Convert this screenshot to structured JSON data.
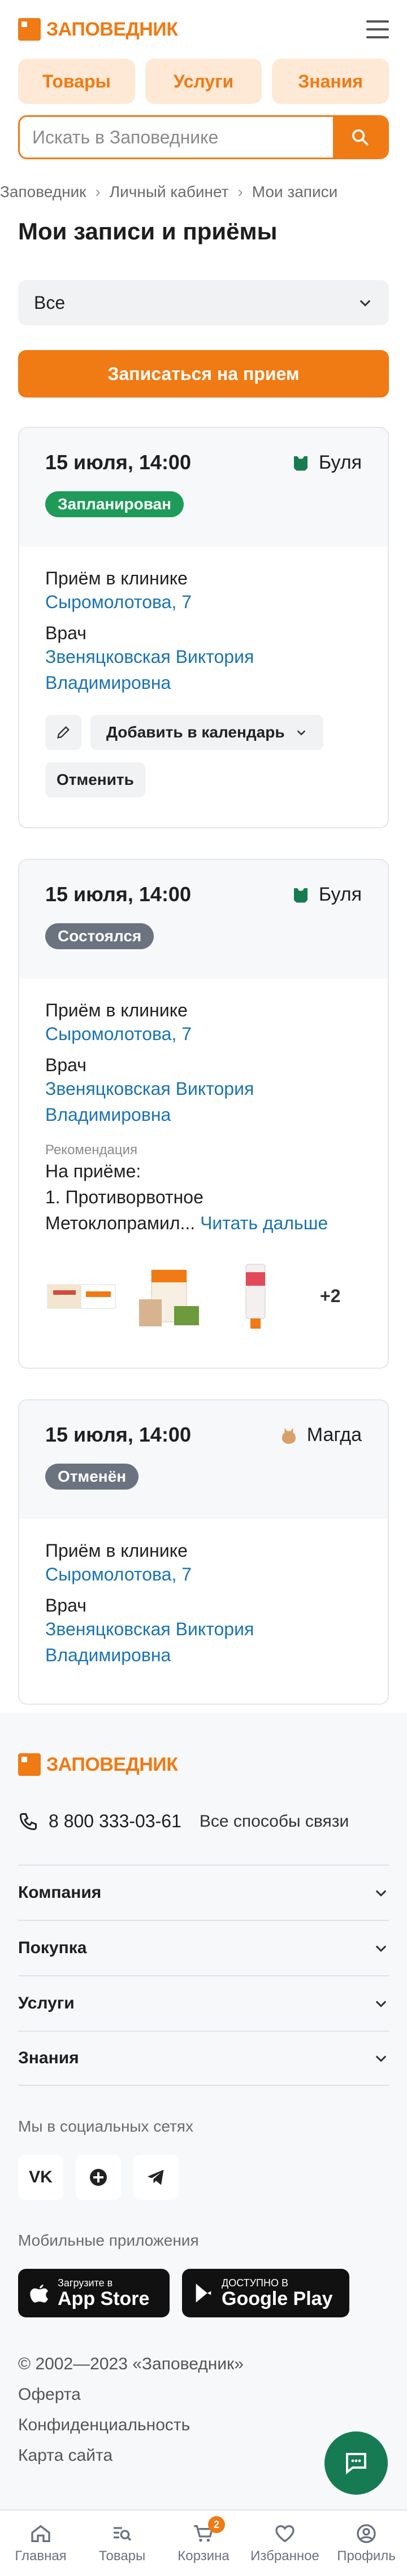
{
  "header": {
    "logo_text": "ЗАПОВЕДНИК",
    "menu_icon": "hamburger-icon"
  },
  "nav_pills": [
    "Товары",
    "Услуги",
    "Знания"
  ],
  "search": {
    "placeholder": "Искать в Заповеднике"
  },
  "breadcrumbs": [
    "Заповедник",
    "Личный кабинет",
    "Мои записи"
  ],
  "page": {
    "title": "Мои записи и приёмы",
    "filter_value": "Все",
    "cta_label": "Записаться на прием"
  },
  "appointments": [
    {
      "when": "15 июля, 14:00",
      "pet": "Буля",
      "status": "Запланирован",
      "status_color": "#1e9b58",
      "place_label": "Приём в клинике",
      "place_link": "Сыромолотова, 7",
      "doctor_label": "Врач",
      "doctor_name_1": "Звеняцковская Виктория",
      "doctor_name_2": "Владимировна",
      "calendar_label": "Добавить в календарь",
      "cancel_label": "Отменить"
    },
    {
      "when": "15 июля, 14:00",
      "pet": "Буля",
      "status": "Состоялся",
      "status_color": "#6b7280",
      "place_label": "Приём в клинике",
      "place_link": "Сыромолотова, 7",
      "doctor_label": "Врач",
      "doctor_name_1": "Звеняцковская Виктория",
      "doctor_name_2": "Владимировна",
      "rec_label": "Рекомендация",
      "rec_line1": "На приёме:",
      "rec_line2": "1. Противорвотное",
      "rec_line3": "Метоклопрамил...",
      "read_more": "Читать дальше",
      "more_products": "+2"
    },
    {
      "when": "15 июля, 14:00",
      "pet": "Магда",
      "status": "Отменён",
      "status_color": "#6b7280",
      "place_label": "Приём в клинике",
      "place_link": "Сыромолотова, 7",
      "doctor_label": "Врач",
      "doctor_name_1": "Звеняцковская Виктория",
      "doctor_name_2": "Владимировна"
    }
  ],
  "footer": {
    "phone": "8 800 333-03-61",
    "all_contacts": "Все способы связи",
    "sections": [
      "Компания",
      "Покупка",
      "Услуги",
      "Знания"
    ],
    "social_label": "Мы в социальных сетях",
    "apps_label": "Мобильные приложения",
    "appstore_small": "Загрузите в",
    "appstore_big": "App Store",
    "gplay_small": "ДОСТУПНО В",
    "gplay_big": "Google Play",
    "copyright": "© 2002—2023 «Заповедник»",
    "links": [
      "Оферта",
      "Конфиденциальность",
      "Карта сайта"
    ]
  },
  "tabbar": {
    "items": [
      "Главная",
      "Товары",
      "Корзина",
      "Избранное",
      "Профиль"
    ],
    "cart_count": "2"
  },
  "colors": {
    "accent": "#f07a13",
    "link": "#1a73b5",
    "chat": "#167a53"
  }
}
